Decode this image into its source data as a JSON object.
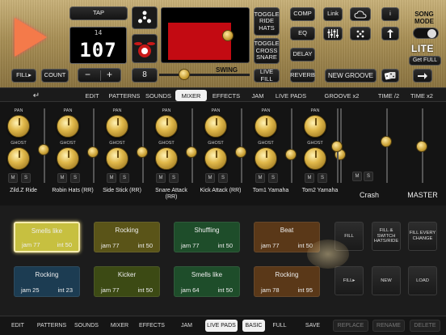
{
  "transport": {
    "tap_label": "TAP",
    "bar_number": "14",
    "tempo": "107",
    "fill_label": "FILL▸",
    "count_label": "COUNT",
    "minus_label": "−",
    "plus_label": "+",
    "beats": "8",
    "swing_label": "SWING",
    "swing_value": 0.28
  },
  "controls": {
    "toggle_ride_hats": "TOGGLE RIDE HATS",
    "toggle_cross_snare": "TOGGLE CROSS SNARE",
    "live_fill": "LIVE FILL",
    "comp": "COMP",
    "eq": "EQ",
    "delay": "DELAY",
    "reverb": "REVERB",
    "link": "Link",
    "info": "i",
    "new_groove": "NEW GROOVE",
    "song_mode": "SONG MODE",
    "lite": "LITE",
    "get_full": "Get FULL"
  },
  "top_tabs": [
    "EDIT",
    "PATTERNS",
    "SOUNDS",
    "MIXER",
    "EFFECTS",
    "JAM",
    "LIVE PADS",
    "GROOVE x2",
    "TIME /2",
    "TIME x2"
  ],
  "active_top_tab": "MIXER",
  "mixer": {
    "pan_label": "PAN",
    "ghost_label": "GHOST",
    "m_label": "M",
    "s_label": "S",
    "channels": [
      {
        "name": "Zild.Z Ride"
      },
      {
        "name": "Robin Hats (RR)"
      },
      {
        "name": "Side Stick (RR)"
      },
      {
        "name": "Snare Attack (RR)"
      },
      {
        "name": "Kick Attack (RR)"
      },
      {
        "name": "Tom1 Yamaha"
      },
      {
        "name": "Tom2 Yamaha"
      }
    ],
    "crash_label": "Crash",
    "master_label": "MASTER"
  },
  "pads": [
    {
      "title": "Smells like",
      "jam": "jam 77",
      "int": "int 50",
      "color": "#c7c040",
      "selected": true
    },
    {
      "title": "Rocking",
      "jam": "jam 77",
      "int": "int 50",
      "color": "#5a5418"
    },
    {
      "title": "Shuffling",
      "jam": "jam 77",
      "int": "int 50",
      "color": "#1e4d2a"
    },
    {
      "title": "Beat",
      "jam": "jam 77",
      "int": "int 50",
      "color": "#5a3818"
    },
    {
      "title": "Rocking",
      "jam": "jam 25",
      "int": "int 23",
      "color": "#1c3c52"
    },
    {
      "title": "Kicker",
      "jam": "jam 77",
      "int": "int 50",
      "color": "#3c4a14"
    },
    {
      "title": "Smells like",
      "jam": "jam 64",
      "int": "int 50",
      "color": "#1e4d2a"
    },
    {
      "title": "Rocking",
      "jam": "jam 78",
      "int": "int 95",
      "color": "#5a3818"
    }
  ],
  "pad_buttons": {
    "fill": "FILL",
    "fill_switch": "FILL & SWITCH HATS/RIDE",
    "fill_every_change": "FILL EVERY CHANGE",
    "fill_arrow": "FILL▸",
    "new": "NEW",
    "load": "LOAD"
  },
  "bottom_tabs": [
    "EDIT",
    "PATTERNS",
    "SOUNDS",
    "MIXER",
    "EFFECTS",
    "JAM",
    "LIVE PADS",
    "BASIC",
    "FULL",
    "SAVE",
    "REPLACE",
    "RENAME",
    "DELETE"
  ],
  "active_bottom_tabs": [
    "LIVE PADS",
    "BASIC"
  ]
}
